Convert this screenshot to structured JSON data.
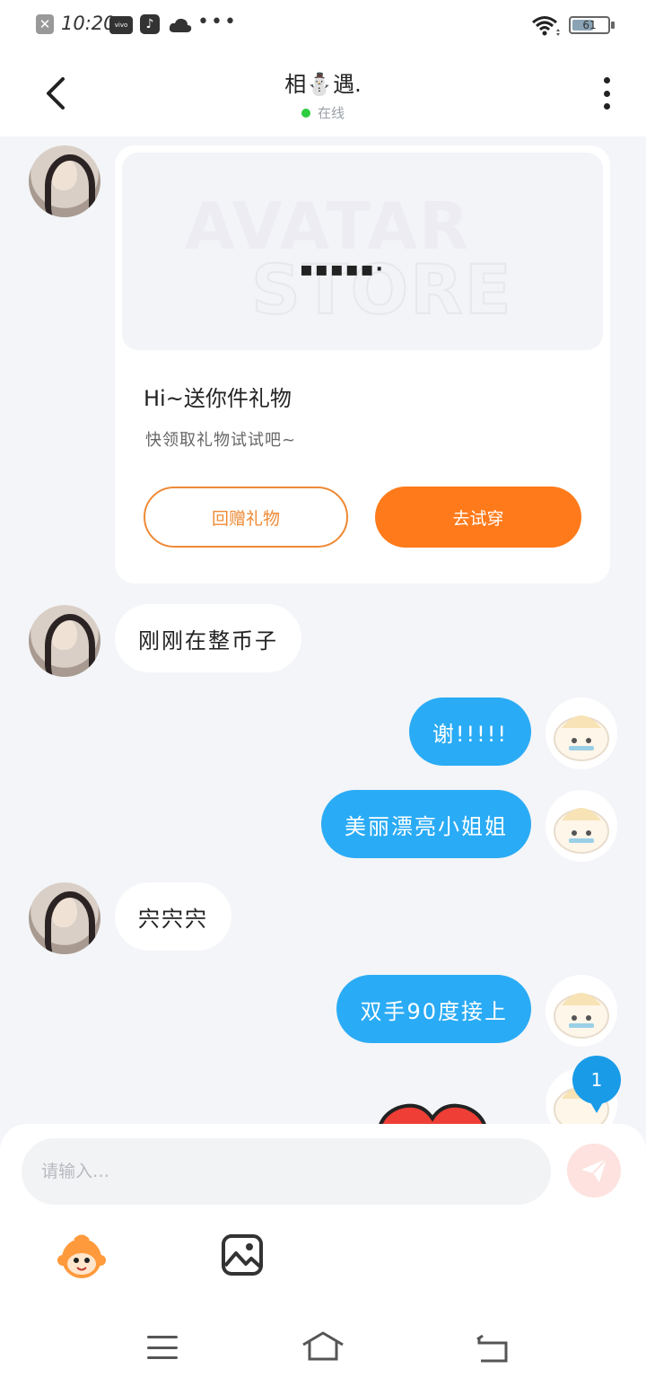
{
  "status_bar": {
    "time": "10:20",
    "battery": "61",
    "battery_level": 0.61,
    "icons": [
      "close-box-icon",
      "vivo-icon",
      "tiktok-icon",
      "cloud-icon",
      "more-dots-icon",
      "wifi-icon",
      "battery-icon"
    ]
  },
  "header": {
    "title": "相⛄遇.",
    "status": "在线",
    "status_color": "#2ecc40"
  },
  "gift_card": {
    "image_watermark_1": "AVATAR",
    "image_watermark_2": "STORE",
    "image_loading": "▪▪▪▪▪·",
    "title": "Hi~送你件礼物",
    "subtitle": "快领取礼物试试吧~",
    "gift_button": "回赠礼物",
    "try_button": "去试穿",
    "accent_color": "#ff7a1a"
  },
  "messages": [
    {
      "side": "in",
      "text": "刚刚在整币子"
    },
    {
      "side": "out",
      "text": "谢!!!!!"
    },
    {
      "side": "out",
      "text": "美丽漂亮小姐姐"
    },
    {
      "side": "in",
      "text": "宍宍宍"
    },
    {
      "side": "out",
      "text": "双手90度接上"
    }
  ],
  "unread_badge": "1",
  "input": {
    "placeholder": "请输入…"
  },
  "colors": {
    "outgoing_bubble": "#2aabf5",
    "background": "#f3f5f8"
  }
}
